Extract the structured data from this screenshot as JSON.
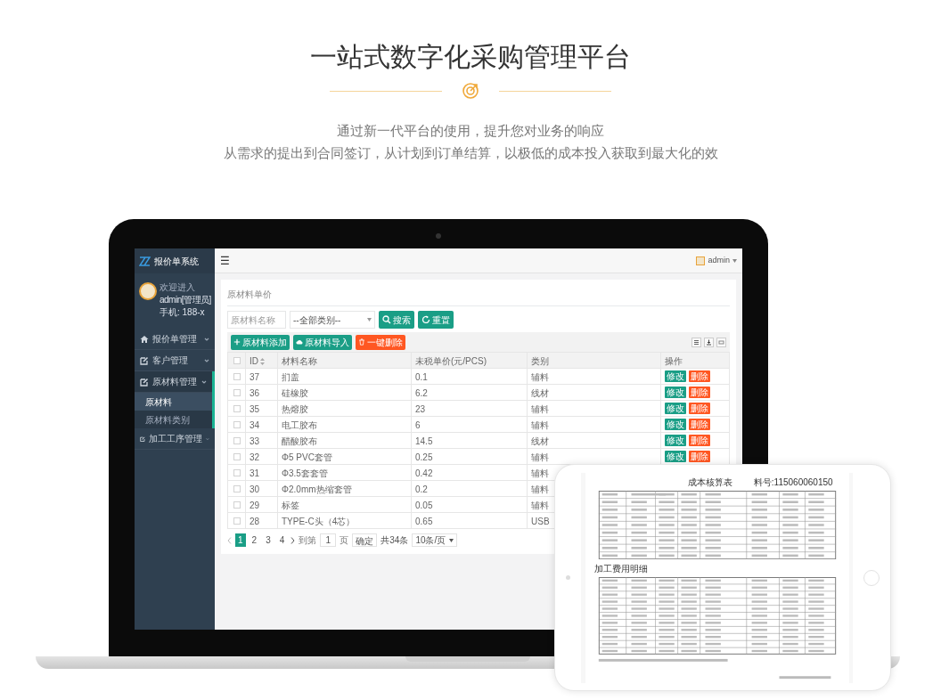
{
  "page": {
    "title": "一站式数字化采购管理平台",
    "subtitle_lines": [
      "通过新一代平台的使用，提升您对业务的响应",
      "从需求的提出到合同签订，从计划到订单结算，以极低的成本投入获取到最大化的效"
    ]
  },
  "app": {
    "logo": "报价单系统",
    "user": {
      "greeting": "欢迎进入",
      "name": "admin[管理员]",
      "phone": "手机: 188-x"
    },
    "menu": [
      {
        "label": "报价单管理",
        "kind": "home",
        "expanded": false
      },
      {
        "label": "客户管理",
        "kind": "edit",
        "expanded": false
      },
      {
        "label": "原材料管理",
        "kind": "edit",
        "expanded": true,
        "children": [
          {
            "label": "原材料",
            "selected": true
          },
          {
            "label": "原材料类别",
            "selected": false
          }
        ]
      },
      {
        "label": "加工工序管理",
        "kind": "edit",
        "expanded": false
      }
    ],
    "header": {
      "menu_glyph": "☰",
      "user": "admin"
    },
    "breadcrumb": "原材料单价",
    "search": {
      "placeholder": "原材料名称",
      "category": "--全部类别--",
      "buttons": [
        {
          "label": "搜索",
          "kind": "search"
        },
        {
          "label": "重置",
          "kind": "reset"
        }
      ]
    },
    "toolbar": [
      {
        "label": "原材料添加",
        "kind": "add"
      },
      {
        "label": "原材料导入",
        "kind": "import"
      },
      {
        "label": "一键删除",
        "kind": "delete"
      }
    ],
    "table": {
      "select_all_checked": false,
      "columns": [
        {
          "label": "ID",
          "sortable": true
        },
        {
          "label": "材料名称"
        },
        {
          "label": "未税单价(元/PCS)"
        },
        {
          "label": "类别"
        },
        {
          "label": "操作"
        }
      ],
      "rows": [
        {
          "checked": false,
          "id": "37",
          "name": "扪盖",
          "price": "0.1",
          "category": "辅料",
          "actions": [
            "修改",
            "删除"
          ]
        },
        {
          "checked": false,
          "id": "36",
          "name": "硅橡胶",
          "price": "6.2",
          "category": "线材",
          "actions": [
            "修改",
            "删除"
          ]
        },
        {
          "checked": false,
          "id": "35",
          "name": "热熔胶",
          "price": "23",
          "category": "辅料",
          "actions": [
            "修改",
            "删除"
          ]
        },
        {
          "checked": false,
          "id": "34",
          "name": "电工胶布",
          "price": "6",
          "category": "辅料",
          "actions": [
            "修改",
            "删除"
          ]
        },
        {
          "checked": false,
          "id": "33",
          "name": "醋酸胶布",
          "price": "14.5",
          "category": "线材",
          "actions": [
            "修改",
            "删除"
          ]
        },
        {
          "checked": false,
          "id": "32",
          "name": "Φ5 PVC套管",
          "price": "0.25",
          "category": "辅料",
          "actions": [
            "修改",
            "删除"
          ]
        },
        {
          "checked": false,
          "id": "31",
          "name": "Φ3.5套套管",
          "price": "0.42",
          "category": "辅料"
        },
        {
          "checked": false,
          "id": "30",
          "name": "Φ2.0mm热缩套管",
          "price": "0.2",
          "category": "辅料"
        },
        {
          "checked": false,
          "id": "29",
          "name": "标签",
          "price": "0.05",
          "category": "辅料"
        },
        {
          "checked": false,
          "id": "28",
          "name": "TYPE-C头（4芯）",
          "price": "0.65",
          "category": "USB"
        }
      ]
    },
    "pagination": {
      "pages": [
        {
          "label": "1",
          "selected": true
        },
        {
          "label": "2",
          "selected": false
        },
        {
          "label": "3",
          "selected": false
        },
        {
          "label": "4",
          "selected": false
        }
      ],
      "goto_label": "到第",
      "goto_value": "1",
      "page_unit": "页",
      "confirm": "确定",
      "total": "共34条",
      "page_size": "10条/页"
    }
  },
  "tablet": {
    "title": "成本核算表",
    "part_no": "料号:115060060150",
    "section": "加工费用明细"
  }
}
